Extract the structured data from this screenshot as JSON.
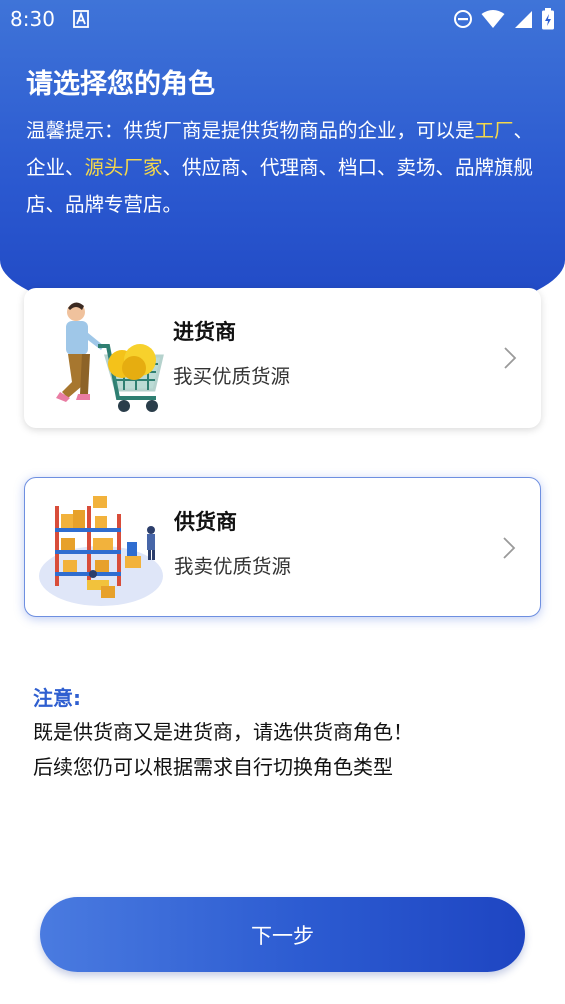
{
  "status_bar": {
    "time": "8:30",
    "icons": [
      "notification-a-icon",
      "dnd-icon",
      "wifi-icon",
      "signal-icon",
      "battery-icon"
    ]
  },
  "header": {
    "title": "请选择您的角色",
    "tip_prefix": "温馨提示：供货厂商是提供货物商品的企业，可以是",
    "tip_highlight_1": "工厂",
    "tip_sep_1": "、企业、",
    "tip_highlight_2": "源头厂家",
    "tip_suffix": "、供应商、代理商、档口、卖场、品牌旗舰店、品牌专营店。",
    "highlight_color": "#f5d84a"
  },
  "roles": [
    {
      "title": "进货商",
      "subtitle": "我买优质货源",
      "icon": "buyer-cart-illustration"
    },
    {
      "title": "供货商",
      "subtitle": "我卖优质货源",
      "icon": "warehouse-illustration"
    }
  ],
  "note": {
    "title": "注意:",
    "line1": "既是供货商又是进货商，请选供货商角色！",
    "line2": "后续您仍可以根据需求自行切换角色类型"
  },
  "next_button": {
    "label": "下一步"
  },
  "colors": {
    "brand_blue": "#2b59d0",
    "note_blue": "#2f5fd0"
  }
}
